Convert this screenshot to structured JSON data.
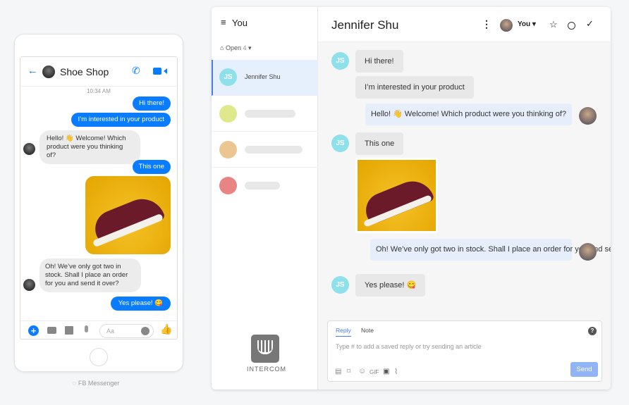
{
  "messenger": {
    "title": "Shoe Shop",
    "time": "10:34 AM",
    "messages": [
      {
        "from": "user",
        "text": "Hi there!"
      },
      {
        "from": "user",
        "text": "I’m interested in your product"
      },
      {
        "from": "shop",
        "text": "Hello! 👋  Welcome! Which product were you thinking of?"
      },
      {
        "from": "user",
        "text": "This one"
      },
      {
        "from": "shop",
        "text": "Oh! We’ve only got two in stock. Shall I place an order for you and send it over?"
      },
      {
        "from": "user",
        "text": "Yes please! 😋"
      }
    ],
    "input_placeholder": "Aa",
    "caption": "FB Messenger",
    "accent": "#0a7cff"
  },
  "intercom": {
    "inbox_title": "You",
    "filter_label": "Open",
    "filter_count": "4",
    "conversations": [
      {
        "initials": "JS",
        "name": "Jennifer Shu"
      }
    ],
    "placeholder_colors": [
      "#dfe98c",
      "#ecc690",
      "#e98484"
    ],
    "logo_text": "INTERCOM",
    "header": {
      "name": "Jennifer Shu",
      "assignee": "You"
    },
    "messages": [
      {
        "from": "customer",
        "text": "Hi there!"
      },
      {
        "from": "customer",
        "text": "I’m interested in your product"
      },
      {
        "from": "admin",
        "text": "Hello! 👋  Welcome! Which product were you thinking of?"
      },
      {
        "from": "customer",
        "text": "This one"
      },
      {
        "from": "admin",
        "text": "Oh! We’ve only got two in stock. Shall I place an order for you and send it over?"
      },
      {
        "from": "customer",
        "text": "Yes please! 😋"
      }
    ],
    "composer": {
      "tab_reply": "Reply",
      "tab_note": "Note",
      "placeholder": "Type # to add a saved reply or try sending an article",
      "gif": "GIF",
      "send": "Send"
    },
    "accent": "#4a7cf0"
  }
}
